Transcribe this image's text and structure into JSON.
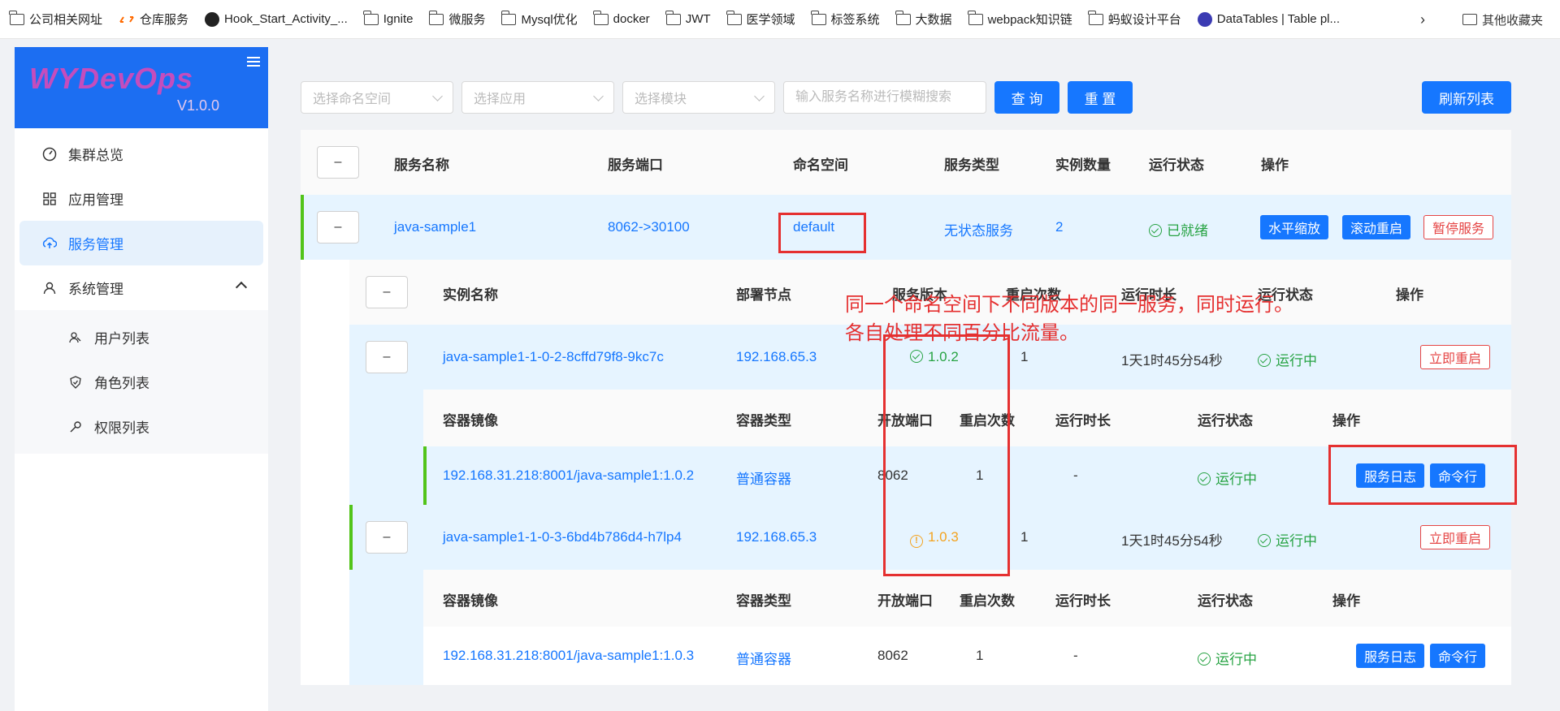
{
  "bookmarks": [
    {
      "label": "公司相关网址",
      "icon": "folder-icon"
    },
    {
      "label": "仓库服务",
      "icon": "cloud-icon"
    },
    {
      "label": "Hook_Start_Activity_...",
      "icon": "github-icon"
    },
    {
      "label": "Ignite",
      "icon": "folder-icon"
    },
    {
      "label": "微服务",
      "icon": "folder-icon"
    },
    {
      "label": "Mysql优化",
      "icon": "folder-icon"
    },
    {
      "label": "docker",
      "icon": "folder-icon"
    },
    {
      "label": "JWT",
      "icon": "folder-icon"
    },
    {
      "label": "医学领域",
      "icon": "folder-icon"
    },
    {
      "label": "标签系统",
      "icon": "folder-icon"
    },
    {
      "label": "大数据",
      "icon": "folder-icon"
    },
    {
      "label": "webpack知识链",
      "icon": "folder-icon"
    },
    {
      "label": "蚂蚁设计平台",
      "icon": "folder-icon"
    },
    {
      "label": "DataTables | Table pl...",
      "icon": "datatables-icon"
    }
  ],
  "bookmarks_more": "›",
  "bookmarks_other": "其他收藏夹",
  "logo": {
    "title": "WYDevOps",
    "version": "V1.0.0"
  },
  "menu": {
    "cluster": "集群总览",
    "apps": "应用管理",
    "services": "服务管理",
    "system": "系统管理",
    "users": "用户列表",
    "roles": "角色列表",
    "perms": "权限列表"
  },
  "filters": {
    "namespace_placeholder": "选择命名空间",
    "app_placeholder": "选择应用",
    "module_placeholder": "选择模块",
    "search_placeholder": "输入服务名称进行模糊搜索",
    "query": "查 询",
    "reset": "重 置",
    "refresh": "刷新列表"
  },
  "service_headers": {
    "expand": "–",
    "name": "服务名称",
    "port": "服务端口",
    "namespace": "命名空间",
    "type": "服务类型",
    "instances": "实例数量",
    "status": "运行状态",
    "actions": "操作"
  },
  "service": {
    "expand": "–",
    "name": "java-sample1",
    "port": "8062->30100",
    "namespace": "default",
    "type": "无状态服务",
    "instances": "2",
    "status": "已就绪",
    "scale": "水平缩放",
    "rolling_restart": "滚动重启",
    "stop": "暂停服务"
  },
  "instance_headers": {
    "expand": "–",
    "name": "实例名称",
    "node": "部署节点",
    "version": "服务版本",
    "restarts": "重启次数",
    "uptime": "运行时长",
    "status": "运行状态",
    "actions": "操作"
  },
  "instances": [
    {
      "expand": "–",
      "name": "java-sample1-1-0-2-8cffd79f8-9kc7c",
      "node": "192.168.65.3",
      "version": "1.0.2",
      "restarts": "1",
      "uptime": "1天1时45分54秒",
      "status": "运行中",
      "restart_now": "立即重启",
      "container_headers": {
        "image": "容器镜像",
        "type": "容器类型",
        "ports": "开放端口",
        "restarts": "重启次数",
        "uptime": "运行时长",
        "status": "运行状态",
        "actions": "操作"
      },
      "container": {
        "image": "192.168.31.218:8001/java-sample1:1.0.2",
        "type": "普通容器",
        "ports": "8062",
        "restarts": "1",
        "uptime": "-",
        "status": "运行中",
        "logs": "服务日志",
        "shell": "命令行"
      }
    },
    {
      "expand": "–",
      "name": "java-sample1-1-0-3-6bd4b786d4-h7lp4",
      "node": "192.168.65.3",
      "version": "1.0.3",
      "restarts": "1",
      "uptime": "1天1时45分54秒",
      "status": "运行中",
      "restart_now": "立即重启",
      "container_headers": {
        "image": "容器镜像",
        "type": "容器类型",
        "ports": "开放端口",
        "restarts": "重启次数",
        "uptime": "运行时长",
        "status": "运行状态",
        "actions": "操作"
      },
      "container": {
        "image": "192.168.31.218:8001/java-sample1:1.0.3",
        "type": "普通容器",
        "ports": "8062",
        "restarts": "1",
        "uptime": "-",
        "status": "运行中",
        "logs": "服务日志",
        "shell": "命令行"
      }
    }
  ],
  "annotation": {
    "line1": "同一个命名空间下不同版本的同一服务，同时运行。",
    "line2": "各自处理不同百分比流量。"
  },
  "colors": {
    "accent": "#1677ff",
    "success": "#27a343",
    "warning": "#f3a320",
    "danger": "#e53030"
  }
}
